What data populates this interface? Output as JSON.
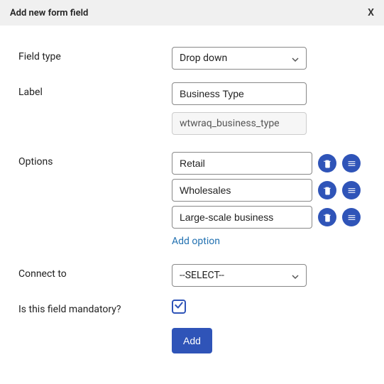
{
  "header": {
    "title": "Add new form field",
    "close": "X"
  },
  "fields": {
    "field_type": {
      "label": "Field type",
      "value": "Drop down"
    },
    "label": {
      "label": "Label",
      "value": "Business Type",
      "slug": "wtwraq_business_type"
    },
    "options": {
      "label": "Options",
      "items": [
        "Retail",
        "Wholesales",
        "Large-scale business"
      ],
      "add_link": "Add option"
    },
    "connect_to": {
      "label": "Connect to",
      "value": "--SELECT--"
    },
    "mandatory": {
      "label": "Is this field mandatory?",
      "checked": true
    }
  },
  "actions": {
    "submit": "Add"
  }
}
